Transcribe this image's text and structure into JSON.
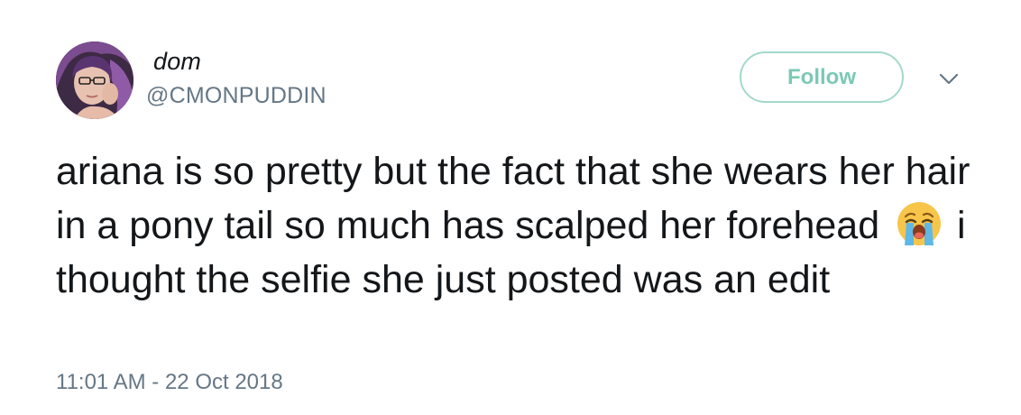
{
  "user": {
    "display_name": "dom",
    "handle": "@CMONPUDDIN"
  },
  "follow_button": {
    "label": "Follow"
  },
  "menu": {
    "icon": "chevron-down-icon"
  },
  "tweet": {
    "text_before_emoji": "ariana is so pretty but the fact that she wears her hair in a pony tail so much has scalped her forehead ",
    "emoji": "loudly-crying-face",
    "text_after_emoji": " i thought the selfie she just posted was an edit",
    "timestamp": "11:01 AM - 22 Oct 2018"
  },
  "colors": {
    "follow_border": "#a3d9cc",
    "follow_text": "#7cc9b5",
    "secondary_text": "#657786",
    "primary_text": "#14171a"
  }
}
